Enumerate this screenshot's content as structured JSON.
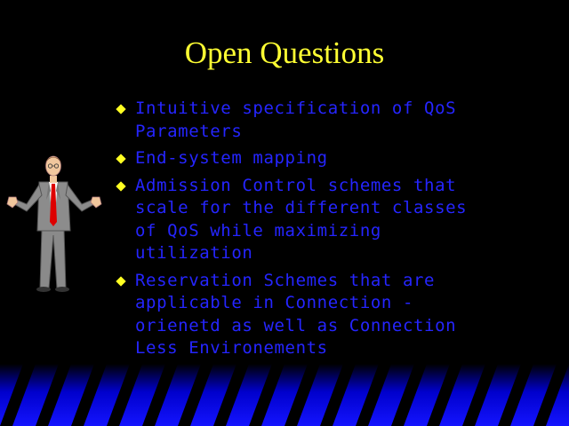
{
  "slide": {
    "title": "Open Questions",
    "bullets": [
      {
        "lines": [
          "Intuitive specification of QoS",
          "Parameters"
        ]
      },
      {
        "lines": [
          "End-system mapping"
        ]
      },
      {
        "lines": [
          "Admission Control schemes that",
          "scale for the different classes",
          "of QoS while maximizing",
          "utilization"
        ]
      },
      {
        "lines": [
          "Reservation Schemes that are",
          "applicable in Connection -",
          "orienetd as well as Connection",
          "Less Environements"
        ]
      }
    ]
  },
  "colors": {
    "background": "#000000",
    "title": "#ffff33",
    "bullet_text": "#2525ff",
    "bullet_marker": "#ffff22",
    "stripe_band": "#1414ff"
  },
  "icons": {
    "figure": "presenter-figure-icon",
    "bullet": "diamond-bullet-icon"
  }
}
